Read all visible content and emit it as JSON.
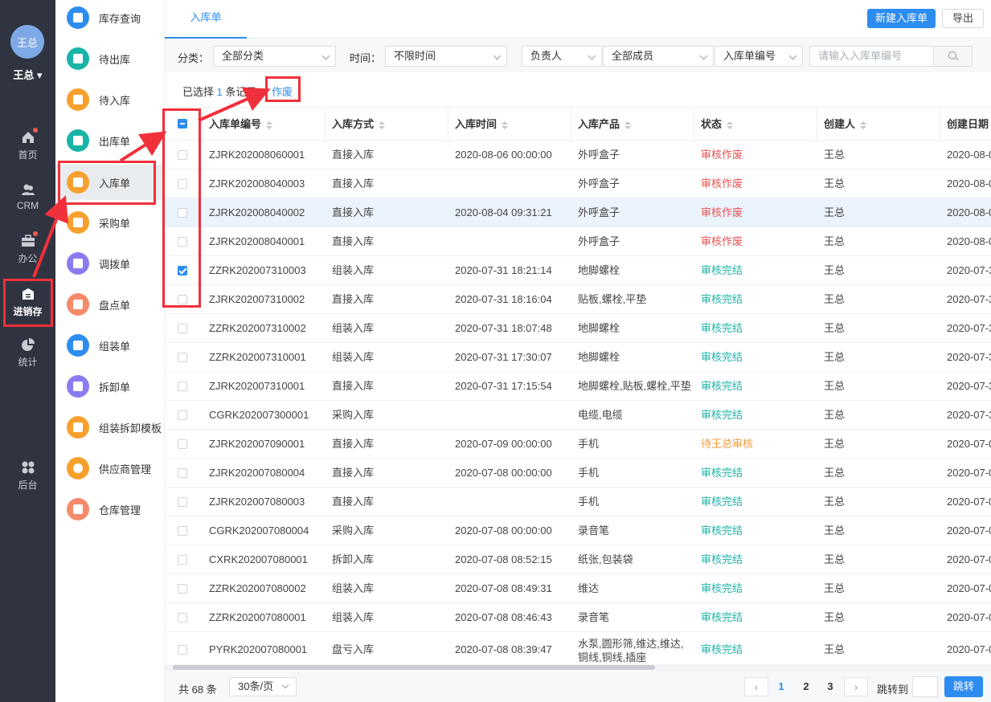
{
  "user": {
    "avatar_text": "王总",
    "name": "王总 ▾"
  },
  "leftnav": [
    {
      "key": "home",
      "label": "首页",
      "icon": "home-icon",
      "dot": true
    },
    {
      "key": "crm",
      "label": "CRM",
      "icon": "people-icon",
      "dot": false
    },
    {
      "key": "office",
      "label": "办公",
      "icon": "briefcase-icon",
      "dot": true
    },
    {
      "key": "inventory",
      "label": "进销存",
      "icon": "warehouse-icon",
      "dot": false,
      "active": true
    },
    {
      "key": "stats",
      "label": "统计",
      "icon": "pie-chart-icon",
      "dot": false
    },
    {
      "key": "admin",
      "label": "后台",
      "icon": "grid-icon",
      "dot": false
    }
  ],
  "submenu": [
    {
      "label": "库存查询",
      "color": "#2d8cf0"
    },
    {
      "label": "待出库",
      "color": "#19b4a8"
    },
    {
      "label": "待入库",
      "color": "#f7a02d"
    },
    {
      "label": "出库单",
      "color": "#19b4a8"
    },
    {
      "label": "入库单",
      "color": "#f7a02d",
      "active": true
    },
    {
      "label": "采购单",
      "color": "#f7a02d"
    },
    {
      "label": "调拨单",
      "color": "#8a7cf0"
    },
    {
      "label": "盘点单",
      "color": "#f58a6a"
    },
    {
      "label": "组装单",
      "color": "#2d8cf0"
    },
    {
      "label": "拆卸单",
      "color": "#8a7cf0"
    },
    {
      "label": "组装拆卸模板",
      "color": "#f7a02d"
    },
    {
      "label": "供应商管理",
      "color": "#f7a02d"
    },
    {
      "label": "仓库管理",
      "color": "#f58a6a"
    }
  ],
  "tabbar": {
    "active_tab": "入库单",
    "new_button": "新建入库单",
    "export_button": "导出"
  },
  "filters": {
    "category_label": "分类：",
    "category_value": "全部分类",
    "time_label": "时间：",
    "time_value": "不限时间",
    "owner_value": "负责人",
    "members_value": "全部成员",
    "field_value": "入库单编号",
    "search_placeholder": "请输入入库单编号"
  },
  "selection": {
    "prefix": "已选择",
    "count": "1",
    "suffix": "条记录",
    "void_action": "作废"
  },
  "table": {
    "headers": [
      "入库单编号",
      "入库方式",
      "入库时间",
      "入库产品",
      "状态",
      "创建人",
      "创建日期"
    ],
    "rows": [
      {
        "code": "ZJRK202008060001",
        "method": "直接入库",
        "time": "2020-08-06 00:00:00",
        "product": "外呼盒子",
        "status": "审核作废",
        "tone": "red",
        "creator": "王总",
        "date": "2020-08-0",
        "checked": false,
        "hl": false
      },
      {
        "code": "ZJRK202008040003",
        "method": "直接入库",
        "time": "",
        "product": "外呼盒子",
        "status": "审核作废",
        "tone": "red",
        "creator": "王总",
        "date": "2020-08-0",
        "checked": false,
        "hl": false
      },
      {
        "code": "ZJRK202008040002",
        "method": "直接入库",
        "time": "2020-08-04 09:31:21",
        "product": "外呼盒子",
        "status": "审核作废",
        "tone": "red",
        "creator": "王总",
        "date": "2020-08-0",
        "checked": false,
        "hl": true
      },
      {
        "code": "ZJRK202008040001",
        "method": "直接入库",
        "time": "",
        "product": "外呼盒子",
        "status": "审核作废",
        "tone": "red",
        "creator": "王总",
        "date": "2020-08-0",
        "checked": false,
        "hl": false
      },
      {
        "code": "ZZRK202007310003",
        "method": "组装入库",
        "time": "2020-07-31 18:21:14",
        "product": "地脚螺栓",
        "status": "审核完结",
        "tone": "green",
        "creator": "王总",
        "date": "2020-07-3",
        "checked": true,
        "hl": false
      },
      {
        "code": "ZJRK202007310002",
        "method": "直接入库",
        "time": "2020-07-31 18:16:04",
        "product": "贴板,螺栓,平垫",
        "status": "审核完结",
        "tone": "green",
        "creator": "王总",
        "date": "2020-07-3",
        "checked": false,
        "hl": false
      },
      {
        "code": "ZZRK202007310002",
        "method": "组装入库",
        "time": "2020-07-31 18:07:48",
        "product": "地脚螺栓",
        "status": "审核完结",
        "tone": "green",
        "creator": "王总",
        "date": "2020-07-3",
        "checked": false,
        "hl": false
      },
      {
        "code": "ZZRK202007310001",
        "method": "组装入库",
        "time": "2020-07-31 17:30:07",
        "product": "地脚螺栓",
        "status": "审核完结",
        "tone": "green",
        "creator": "王总",
        "date": "2020-07-3",
        "checked": false,
        "hl": false
      },
      {
        "code": "ZJRK202007310001",
        "method": "直接入库",
        "time": "2020-07-31 17:15:54",
        "product": "地脚螺栓,贴板,螺栓,平垫",
        "status": "审核完结",
        "tone": "green",
        "creator": "王总",
        "date": "2020-07-3",
        "checked": false,
        "hl": false
      },
      {
        "code": "CGRK202007300001",
        "method": "采购入库",
        "time": "",
        "product": "电缆,电缆",
        "status": "审核完结",
        "tone": "green",
        "creator": "王总",
        "date": "2020-07-3",
        "checked": false,
        "hl": false
      },
      {
        "code": "ZJRK202007090001",
        "method": "直接入库",
        "time": "2020-07-09 00:00:00",
        "product": "手机",
        "status": "待王总审核",
        "tone": "orange",
        "creator": "王总",
        "date": "2020-07-0",
        "checked": false,
        "hl": false
      },
      {
        "code": "ZJRK202007080004",
        "method": "直接入库",
        "time": "2020-07-08 00:00:00",
        "product": "手机",
        "status": "审核完结",
        "tone": "green",
        "creator": "王总",
        "date": "2020-07-0",
        "checked": false,
        "hl": false
      },
      {
        "code": "ZJRK202007080003",
        "method": "直接入库",
        "time": "",
        "product": "手机",
        "status": "审核完结",
        "tone": "green",
        "creator": "王总",
        "date": "2020-07-0",
        "checked": false,
        "hl": false
      },
      {
        "code": "CGRK202007080004",
        "method": "采购入库",
        "time": "2020-07-08 00:00:00",
        "product": "录音笔",
        "status": "审核完结",
        "tone": "green",
        "creator": "王总",
        "date": "2020-07-0",
        "checked": false,
        "hl": false
      },
      {
        "code": "CXRK202007080001",
        "method": "拆卸入库",
        "time": "2020-07-08 08:52:15",
        "product": "纸张,包装袋",
        "status": "审核完结",
        "tone": "green",
        "creator": "王总",
        "date": "2020-07-0",
        "checked": false,
        "hl": false
      },
      {
        "code": "ZZRK202007080002",
        "method": "组装入库",
        "time": "2020-07-08 08:49:31",
        "product": "维达",
        "status": "审核完结",
        "tone": "green",
        "creator": "王总",
        "date": "2020-07-0",
        "checked": false,
        "hl": false
      },
      {
        "code": "ZZRK202007080001",
        "method": "组装入库",
        "time": "2020-07-08 08:46:43",
        "product": "录音笔",
        "status": "审核完结",
        "tone": "green",
        "creator": "王总",
        "date": "2020-07-0",
        "checked": false,
        "hl": false
      },
      {
        "code": "PYRK202007080001",
        "method": "盘亏入库",
        "time": "2020-07-08 08:39:47",
        "product": "水泵,圆形筛,维达,维达,铜线,铜线,插座",
        "status": "审核完结",
        "tone": "green",
        "creator": "王总",
        "date": "2020-07-0",
        "checked": false,
        "hl": false
      }
    ]
  },
  "pagination": {
    "total": "共 68 条",
    "page_size": "30条/页",
    "pages": [
      "1",
      "2",
      "3"
    ],
    "current": "1",
    "prev": "‹",
    "next": "›",
    "jump_label": "跳转到",
    "jump_button": "跳转"
  },
  "colors": {
    "accent": "#2d8cf0",
    "annotation": "#f0303a",
    "nav_bg": "#2f3440"
  }
}
